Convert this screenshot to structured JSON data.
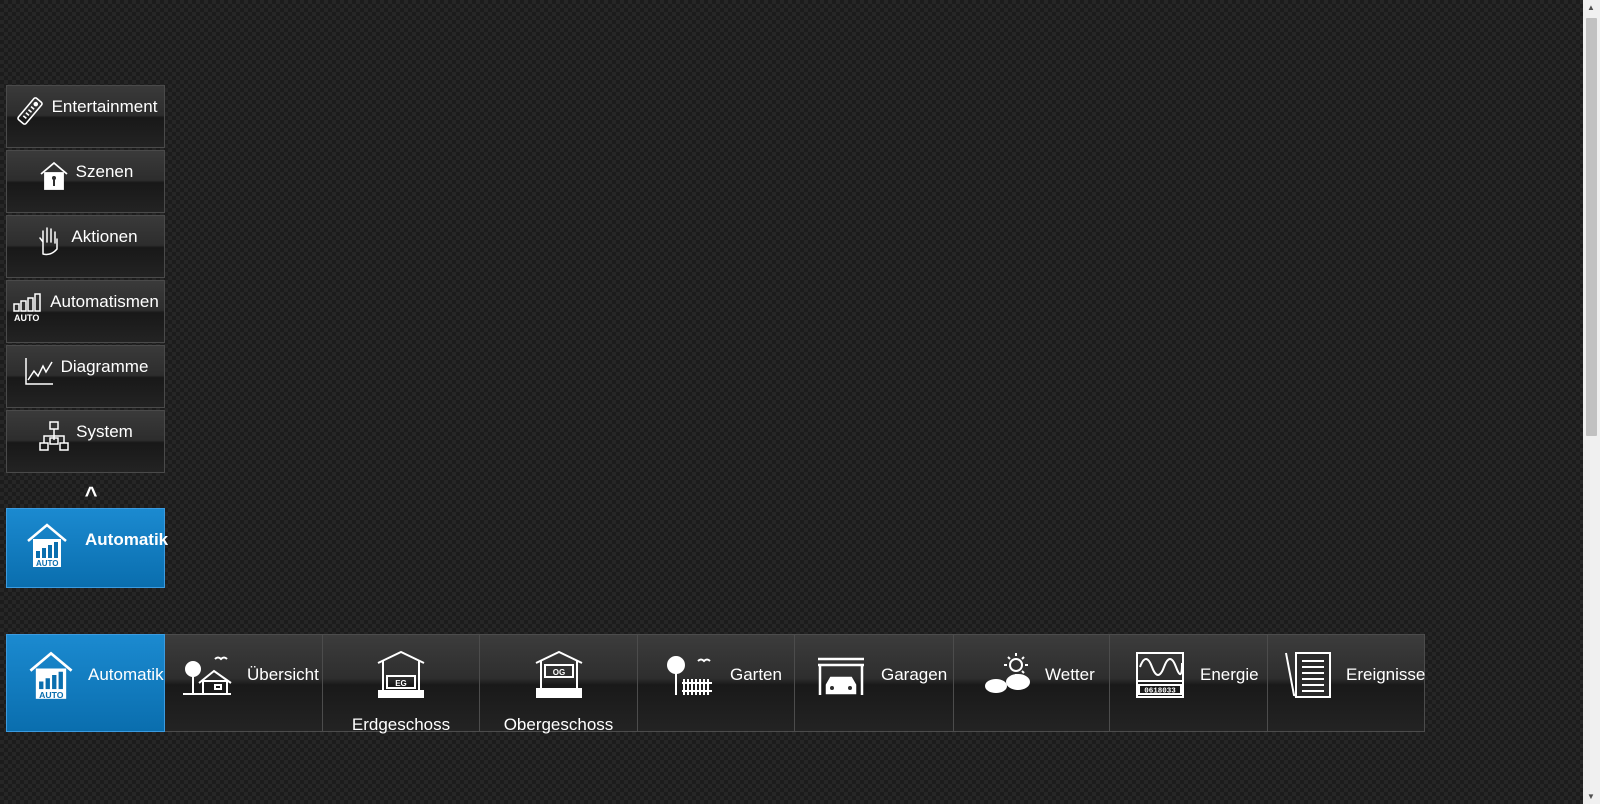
{
  "sidebar": {
    "items": [
      {
        "label": "Entertainment",
        "icon": "remote-control-icon"
      },
      {
        "label": "Szenen",
        "icon": "house-scene-icon"
      },
      {
        "label": "Aktionen",
        "icon": "hand-icon"
      },
      {
        "label": "Automatismen",
        "icon": "auto-bars-icon"
      },
      {
        "label": "Diagramme",
        "icon": "line-chart-icon"
      },
      {
        "label": "System",
        "icon": "network-icon"
      }
    ],
    "collapse_glyph": "^",
    "current": {
      "label": "Automatik",
      "icon": "house-auto-icon"
    }
  },
  "tabs": [
    {
      "label": "Automatik",
      "icon": "house-auto-icon",
      "active": true
    },
    {
      "label": "Übersicht",
      "icon": "house-overview-icon"
    },
    {
      "label": "Erdgeschoss",
      "icon": "floor-eg-icon",
      "badge": "EG"
    },
    {
      "label": "Obergeschoss",
      "icon": "floor-og-icon",
      "badge": "OG"
    },
    {
      "label": "Garten",
      "icon": "garden-icon"
    },
    {
      "label": "Garagen",
      "icon": "garage-icon"
    },
    {
      "label": "Wetter",
      "icon": "weather-icon"
    },
    {
      "label": "Energie",
      "icon": "energy-meter-icon",
      "meter": "0618033"
    },
    {
      "label": "Ereignisse",
      "icon": "events-list-icon"
    }
  ],
  "colors": {
    "accent": "#0a7bc2",
    "background": "#1c1c1c"
  }
}
